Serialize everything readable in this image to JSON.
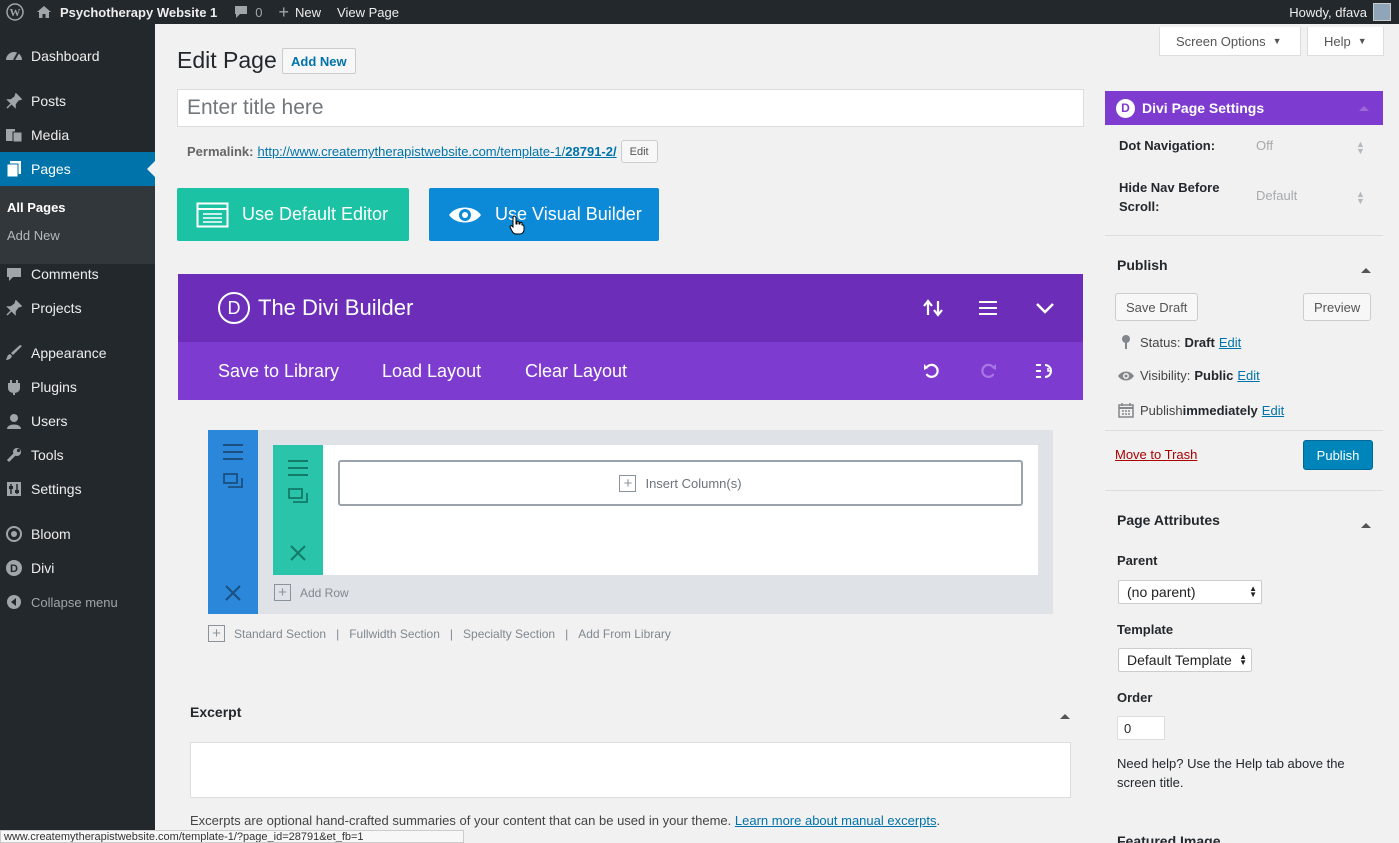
{
  "admin_bar": {
    "site_name": "Psychotherapy Website 1",
    "comments_count": "0",
    "new_label": "New",
    "view_page_label": "View Page",
    "howdy": "Howdy, dfava"
  },
  "sidebar": {
    "items": [
      {
        "label": "Dashboard",
        "icon": "dashboard-icon"
      },
      {
        "label": "Posts",
        "icon": "pin-icon"
      },
      {
        "label": "Media",
        "icon": "media-icon"
      },
      {
        "label": "Pages",
        "icon": "pages-icon"
      },
      {
        "label": "Comments",
        "icon": "comment-icon"
      },
      {
        "label": "Projects",
        "icon": "pin-icon"
      },
      {
        "label": "Appearance",
        "icon": "brush-icon"
      },
      {
        "label": "Plugins",
        "icon": "plugin-icon"
      },
      {
        "label": "Users",
        "icon": "user-icon"
      },
      {
        "label": "Tools",
        "icon": "wrench-icon"
      },
      {
        "label": "Settings",
        "icon": "settings-icon"
      },
      {
        "label": "Bloom",
        "icon": "bloom-icon"
      },
      {
        "label": "Divi",
        "icon": "divi-icon"
      }
    ],
    "submenu": [
      "All Pages",
      "Add New"
    ],
    "collapse_label": "Collapse menu"
  },
  "header": {
    "title": "Edit Page",
    "add_new": "Add New",
    "screen_options": "Screen Options",
    "help": "Help"
  },
  "editor": {
    "title_placeholder": "Enter title here",
    "permalink_label": "Permalink:",
    "permalink_base": "http://www.createmytherapistwebsite.com/template-1/",
    "permalink_slug": "28791-2/",
    "permalink_edit": "Edit",
    "default_editor_btn": "Use Default Editor",
    "visual_builder_btn": "Use Visual Builder"
  },
  "divi": {
    "logo_letter": "D",
    "title": "The Divi Builder",
    "save_to_library": "Save to Library",
    "load_layout": "Load Layout",
    "clear_layout": "Clear Layout",
    "insert_columns": "Insert Column(s)",
    "add_row": "Add Row",
    "section_links": [
      "Standard Section",
      "Fullwidth Section",
      "Specialty Section",
      "Add From Library"
    ],
    "colors": {
      "header": "#6c2eb9",
      "toolbar": "#7e3bd0",
      "section": "#2b87da",
      "row": "#29c4a9"
    }
  },
  "excerpt": {
    "heading": "Excerpt",
    "note": "Excerpts are optional hand-crafted summaries of your content that can be used in your theme.",
    "link": "Learn more about manual excerpts",
    "period": "."
  },
  "status_bar_url": "www.createmytherapistwebsite.com/template-1/?page_id=28791&et_fb=1",
  "divi_settings": {
    "heading": "Divi Page Settings",
    "dot_nav_label": "Dot Navigation:",
    "dot_nav_value": "Off",
    "hide_nav_label": "Hide Nav Before Scroll:",
    "hide_nav_value": "Default"
  },
  "publish": {
    "heading": "Publish",
    "save_draft": "Save Draft",
    "preview": "Preview",
    "status_label": "Status:",
    "status_value": "Draft",
    "visibility_label": "Visibility:",
    "visibility_value": "Public",
    "publish_label": "Publish",
    "publish_value": "immediately",
    "edit": "Edit",
    "move_to_trash": "Move to Trash",
    "publish_btn": "Publish"
  },
  "page_attributes": {
    "heading": "Page Attributes",
    "parent_label": "Parent",
    "parent_value": "(no parent)",
    "template_label": "Template",
    "template_value": "Default Template",
    "order_label": "Order",
    "order_value": "0",
    "help": "Need help? Use the Help tab above the screen title."
  },
  "featured_image": "Featured Image"
}
